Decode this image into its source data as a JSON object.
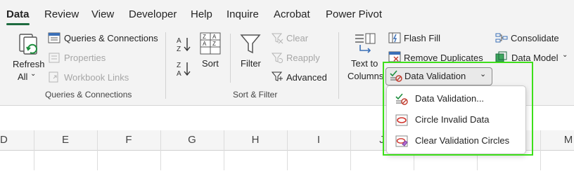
{
  "tabs": [
    "Data",
    "Review",
    "View",
    "Developer",
    "Help",
    "Inquire",
    "Acrobat",
    "Power Pivot"
  ],
  "queries_group": {
    "refresh_label": "Refresh",
    "refresh_sub": "All",
    "queries_connections": "Queries & Connections",
    "properties": "Properties",
    "workbook_links": "Workbook Links",
    "group_label": "Queries & Connections"
  },
  "sort_group": {
    "sort": "Sort",
    "filter": "Filter",
    "clear": "Clear",
    "reapply": "Reapply",
    "advanced": "Advanced",
    "group_label": "Sort & Filter"
  },
  "data_tools": {
    "text_to": "Text to",
    "columns": "Columns",
    "flash_fill": "Flash Fill",
    "remove_duplicates": "Remove Duplicates",
    "data_validation": "Data Validation",
    "consolidate": "Consolidate",
    "data_model": "Data Model"
  },
  "dropdown": {
    "items": [
      "Data Validation...",
      "Circle Invalid Data",
      "Clear Validation Circles"
    ]
  },
  "columns": [
    "D",
    "E",
    "F",
    "G",
    "H",
    "I",
    "J",
    "M"
  ],
  "colors": {
    "accent_green": "#1e6b3f",
    "highlight": "#3ddf1a"
  }
}
